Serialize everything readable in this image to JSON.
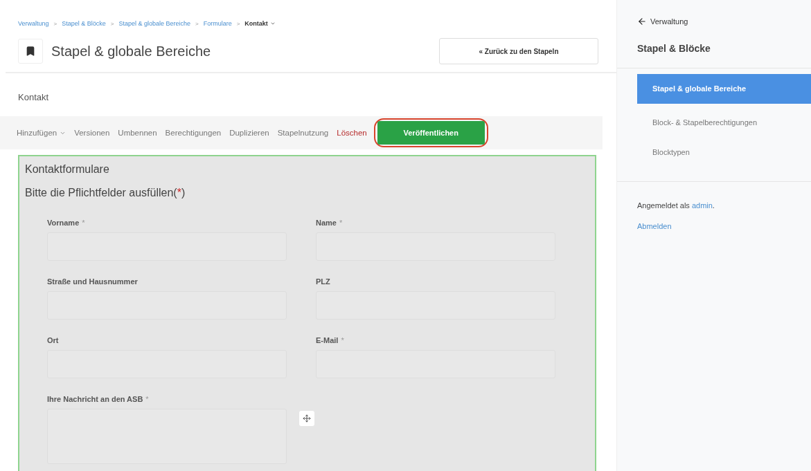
{
  "breadcrumb": [
    {
      "label": "Verwaltung",
      "current": false
    },
    {
      "label": "Stapel & Blöcke",
      "current": false
    },
    {
      "label": "Stapel & globale Bereiche",
      "current": false
    },
    {
      "label": "Formulare",
      "current": false
    },
    {
      "label": "Kontakt",
      "current": true
    }
  ],
  "breadcrumb_separator": ">",
  "page_title": "Stapel & globale Bereiche",
  "back_button": "« Zurück zu den Stapeln",
  "area_name": "Kontakt",
  "toolbar": [
    {
      "label": "Hinzufügen",
      "kind": "dropdown"
    },
    {
      "label": "Versionen",
      "kind": "link"
    },
    {
      "label": "Umbennen",
      "kind": "link"
    },
    {
      "label": "Berechtigungen",
      "kind": "link"
    },
    {
      "label": "Duplizieren",
      "kind": "link"
    },
    {
      "label": "Stapelnutzung",
      "kind": "link"
    },
    {
      "label": "Löschen",
      "kind": "danger"
    },
    {
      "label": "Veröffentlichen",
      "kind": "primary",
      "circled": true
    }
  ],
  "form": {
    "title": "Kontaktformulare",
    "note_prefix": "Bitte die Pflichtfelder ausfüllen(",
    "note_mark": "*",
    "note_suffix": ")",
    "fields": [
      {
        "label": "Vorname",
        "required_mark": "*",
        "kind": "input"
      },
      {
        "label": "Name",
        "required_mark": "*",
        "kind": "input"
      },
      {
        "label": "Straße und Hausnummer",
        "kind": "input"
      },
      {
        "label": "PLZ",
        "kind": "input"
      },
      {
        "label": "Ort",
        "kind": "input"
      },
      {
        "label": "E-Mail",
        "required_mark": "*",
        "kind": "input"
      },
      {
        "label": "Ihre Nachricht an den ASB",
        "required_mark": "*",
        "kind": "textarea"
      }
    ]
  },
  "sidebar": {
    "back_link": "Verwaltung",
    "heading": "Stapel & Blöcke",
    "items": [
      {
        "label": "Stapel & globale Bereiche",
        "selected": true
      },
      {
        "label": "Block- & Stapelberechtigungen",
        "selected": false
      },
      {
        "label": "Blocktypen",
        "selected": false
      }
    ],
    "logged_in_prefix": "Angemeldet als ",
    "user": "admin",
    "logged_in_suffix": ".",
    "logout": "Abmelden"
  }
}
